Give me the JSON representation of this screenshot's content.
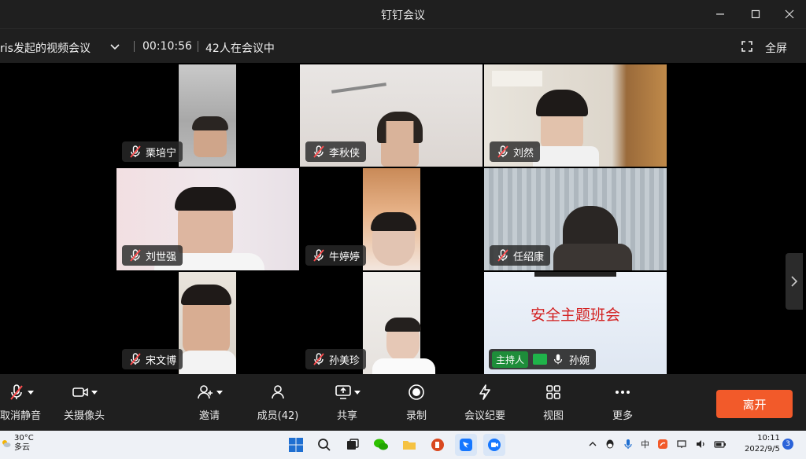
{
  "window": {
    "title": "钉钉会议"
  },
  "infobar": {
    "meeting_title": "ris发起的视频会议",
    "elapsed": "00:10:56",
    "participants_in_meeting": "42人在会议中",
    "fullscreen_label": "全屏"
  },
  "participants": [
    {
      "name": "栗培宁",
      "muted": true
    },
    {
      "name": "李秋侠",
      "muted": true
    },
    {
      "name": "刘然",
      "muted": true
    },
    {
      "name": "刘世强",
      "muted": true
    },
    {
      "name": "牛婷婷",
      "muted": true
    },
    {
      "name": "任绍康",
      "muted": true
    },
    {
      "name": "宋文博",
      "muted": true
    },
    {
      "name": "孙美珍",
      "muted": true
    }
  ],
  "shared_screen": {
    "slide_title": "安全主题班会",
    "host_badge": "主持人",
    "presenter": "孙婉"
  },
  "toolbar": {
    "unmute": "取消静音",
    "camera_off": "关摄像头",
    "invite": "邀请",
    "members": "成员(42)",
    "share": "共享",
    "record": "录制",
    "minutes": "会议纪要",
    "view": "视图",
    "more": "更多",
    "leave": "离开"
  },
  "taskbar": {
    "temperature": "30°C",
    "weather": "多云",
    "ime_label": "中",
    "time": "10:11",
    "date": "2022/9/5",
    "notification_count": "3"
  },
  "colors": {
    "leave_button": "#f25a2a",
    "host_badge": "#1e8d3a",
    "slide_title": "#d32020",
    "toolbar_bg": "#1f1f1f"
  }
}
